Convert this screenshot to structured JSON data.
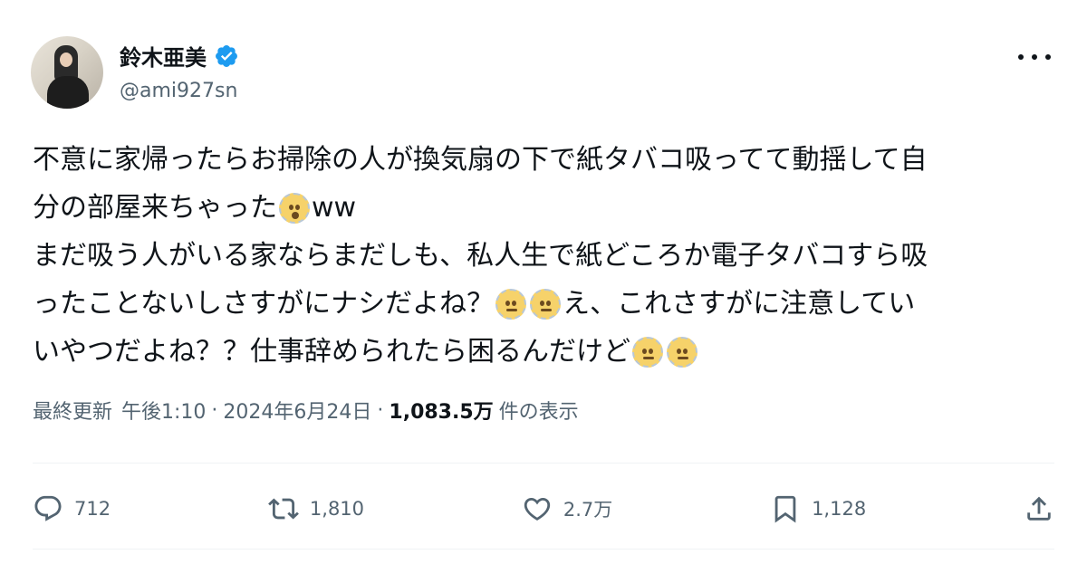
{
  "user": {
    "name": "鈴木亜美",
    "handle": "@ami927sn"
  },
  "tweet": {
    "lines": [
      {
        "before": "不意に家帰ったらお掃除の人が換気扇の下で紙タバコ吸ってて動揺して自",
        "emojis": [],
        "after": ""
      },
      {
        "before": "分の部屋来ちゃった",
        "emojis": [
          "surprise"
        ],
        "after": "ww"
      },
      {
        "before": "まだ吸う人がいる家ならまだしも、私人生で紙どころか電子タバコすら吸",
        "emojis": [],
        "after": ""
      },
      {
        "before": "ったことないしさすがにナシだよね？",
        "emojis": [
          "neutral",
          "neutral"
        ],
        "after": "え、これさすがに注意してい"
      },
      {
        "before": "いやつだよね？？仕事辞められたら困るんだけど",
        "emojis": [
          "neutral",
          "neutral"
        ],
        "after": ""
      }
    ]
  },
  "meta": {
    "updated_label": "最終更新",
    "time": "午後1:10",
    "sep1": "·",
    "date": "2024年6月24日",
    "sep2": "·",
    "views": "1,083.5万",
    "views_label": "件の表示"
  },
  "actions": {
    "reply_count": "712",
    "retweet_count": "1,810",
    "like_count": "2.7万",
    "bookmark_count": "1,128"
  },
  "colors": {
    "verified": "#1d9bf0",
    "muted": "#536471",
    "text": "#0f1419"
  }
}
